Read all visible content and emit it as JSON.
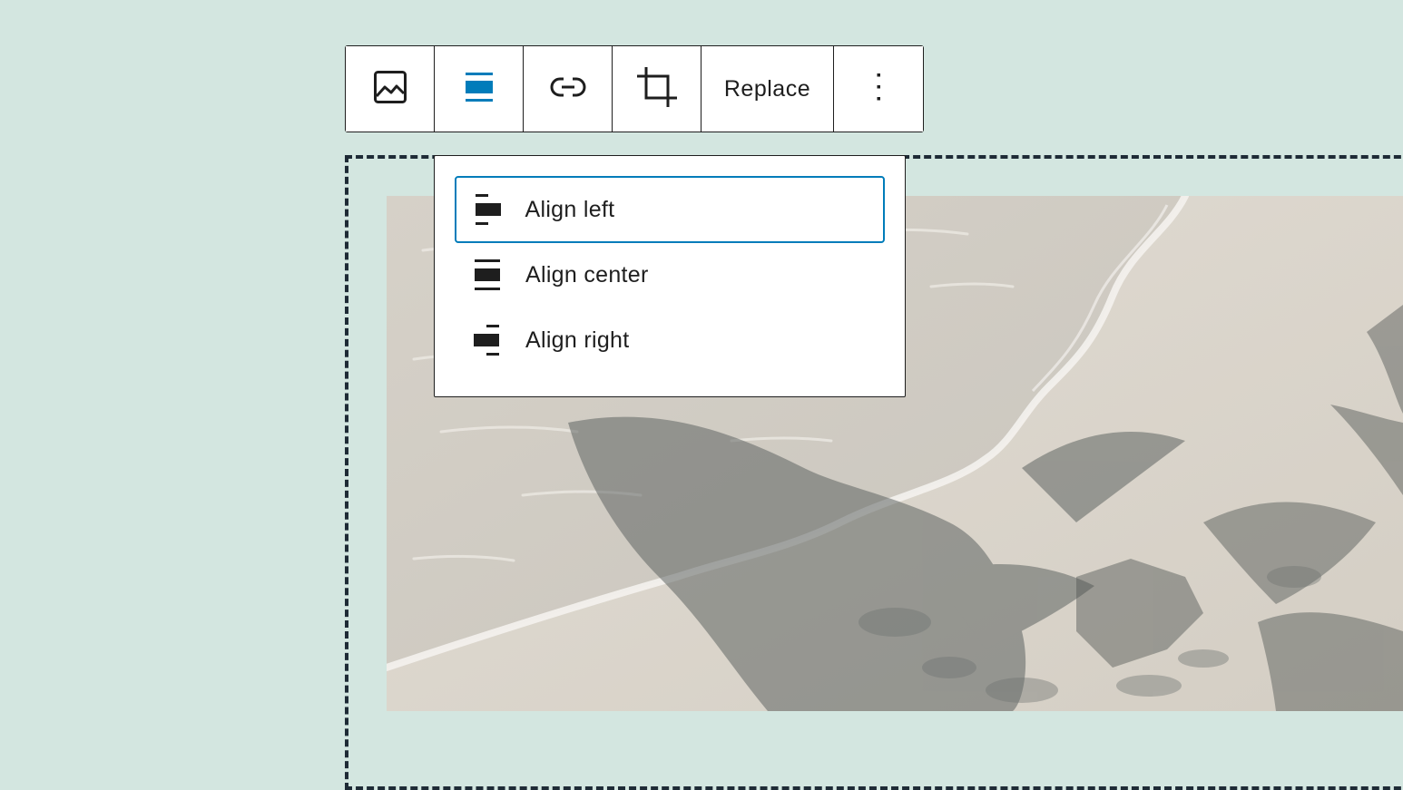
{
  "toolbar": {
    "buttons": [
      {
        "icon": "image-icon"
      },
      {
        "icon": "align-center-icon",
        "active": true,
        "accent": "#007cba"
      },
      {
        "icon": "link-icon"
      },
      {
        "icon": "crop-icon"
      },
      {
        "label": "Replace"
      },
      {
        "icon": "more-vertical-icon"
      }
    ]
  },
  "alignment_menu": {
    "items": [
      {
        "label": "Align left",
        "icon": "align-left-icon",
        "focused": true
      },
      {
        "label": "Align center",
        "icon": "align-center-icon"
      },
      {
        "label": "Align right",
        "icon": "align-right-icon"
      }
    ]
  },
  "colors": {
    "canvas_background": "#d3e6e0",
    "accent": "#007cba",
    "border": "#1e1e1e"
  }
}
